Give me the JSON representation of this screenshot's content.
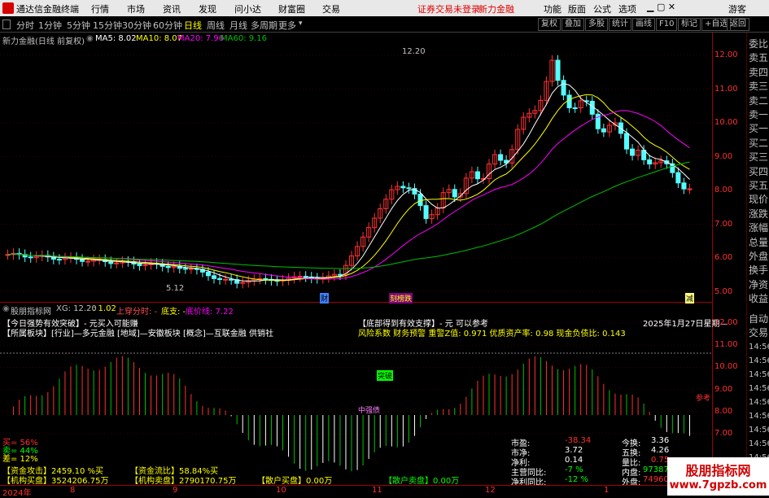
{
  "titlebar": {
    "app_name": "通达信金融终端",
    "menus": [
      "行情",
      "市场",
      "资讯",
      "发现",
      "问小达",
      "财富圈",
      "交易"
    ],
    "warning": "证券交易未登录",
    "stock_name": "新力金融",
    "right_menus": [
      "功能",
      "版面",
      "公式",
      "选项"
    ],
    "guest": "游客"
  },
  "toolbar": {
    "periods": [
      "分时",
      "1分钟",
      "5分钟",
      "15分钟",
      "30分钟",
      "60分钟",
      "日线",
      "周线",
      "月线",
      "多周期",
      "更多"
    ],
    "active_period": "日线",
    "buttons": [
      "复权",
      "叠加",
      "多股",
      "统计",
      "画线",
      "F10",
      "标记",
      "+自选",
      "返回"
    ]
  },
  "price_panel": {
    "header": "新力金融(日线 前复权)",
    "ma5": "MA5: 8.02",
    "ma10": "MA10: 8.07",
    "ma20": "MA20: 7.96",
    "ma60": "MA60: 9.16",
    "high_label": "12.20",
    "low_label": "5.12",
    "markers": [
      "财",
      "刻榜跌",
      "减"
    ],
    "y_ticks": [
      "12.00",
      "11.00",
      "10.00",
      "9.00",
      "8.00",
      "7.00",
      "6.00",
      "5.00"
    ],
    "colors": {
      "ma5": "#ffffff",
      "ma10": "#ffff00",
      "ma20": "#ff00ff",
      "ma60": "#00c000",
      "up": "#ff3232",
      "down": "#54ffff"
    }
  },
  "indicator_panel": {
    "header_name": "股朋指标网",
    "xg": "XG: 12.20",
    "v1": ": 1.02",
    "shang": "上穿分时: -",
    "di": "底支: -",
    "dijia": "底价线: 7.22",
    "line1": "【今日强势有效突破】- 元买入可能赚",
    "line2": "【所属板块】[行业]—多元金融 [地域]—安徽板块 [概念]—互联金融 供销社",
    "line3": "【底部得到有效支撑】- 元 可以参考",
    "line4": "风险系数 财务预警 重警Z值: 0.971 优质资产率: 0.98 现金负债比: 0.143",
    "date": "2025年1月27日星期—",
    "tupo": "突破",
    "zhongyao": "中强债",
    "cankao": "参考",
    "y_ticks": [
      "12.00",
      "11.00",
      "10.00",
      "9.00",
      "8.00",
      "7.00"
    ],
    "buy_pct": "买= 56%",
    "sell_pct": "卖= 44%",
    "diff_pct": "差= 12%",
    "fund_attack": "【资金攻击】2459.10 %买",
    "fund_flow": "【资金流比】58.84%买",
    "inst_buy": "【机构买盘】3524206.75万",
    "inst_sell": "【机构卖盘】2790170.75万",
    "retail_buy": "【散户买盘】0.00万",
    "retail_sell": "【散户卖盘】0.00万",
    "stats": [
      {
        "k": "市盈:",
        "v": "-38.34",
        "k2": "今换:",
        "v2": "3.36"
      },
      {
        "k": "市净:",
        "v": "3.72",
        "k2": "五换:",
        "v2": "4.26"
      },
      {
        "k": "净利:",
        "v": "0.14",
        "k2": "量比:",
        "v2": "0.75"
      },
      {
        "k": "主营同比:",
        "v": "-7 %",
        "k2": "内盘:",
        "v2": "97387"
      },
      {
        "k": "净利同比:",
        "v": "-12 %",
        "k2": "外盘:",
        "v2": "74960"
      }
    ]
  },
  "x_axis": [
    "2024年",
    "8",
    "9",
    "10",
    "11",
    "12",
    "1"
  ],
  "right_strip": {
    "top": [
      "委比",
      "卖五",
      "卖四",
      "卖三",
      "卖二",
      "卖一",
      "买一",
      "买二",
      "买三",
      "买四",
      "买五",
      "现价",
      "涨跌",
      "涨幅",
      "总量",
      "外盘",
      "换手",
      "净资",
      "收益"
    ],
    "bottom": [
      "自动",
      "交易",
      "14:56",
      "14:56",
      "14:56",
      "14:56",
      "14:56",
      "14:56",
      "14:56",
      "14:56",
      "14:56"
    ]
  },
  "watermark": {
    "name": "股朋指标网",
    "url": "www.7gpzb.com"
  }
}
